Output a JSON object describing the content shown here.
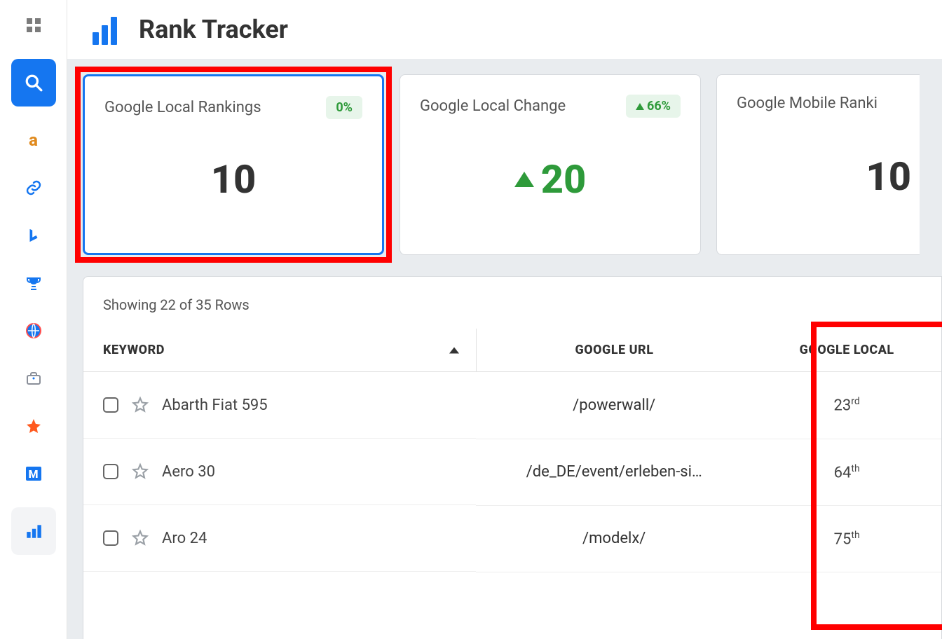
{
  "page": {
    "title": "Rank Tracker"
  },
  "cards": [
    {
      "title": "Google Local Rankings",
      "badge": "0%",
      "badge_trend": "none",
      "value": "10",
      "value_trend": "none",
      "selected": true,
      "highlight": true
    },
    {
      "title": "Google Local Change",
      "badge": "66%",
      "badge_trend": "up",
      "value": "20",
      "value_trend": "up",
      "selected": false,
      "highlight": false
    },
    {
      "title": "Google Mobile Ranki",
      "badge": "",
      "badge_trend": "none",
      "value": "10",
      "value_trend": "none",
      "selected": false,
      "highlight": false,
      "cut": true
    }
  ],
  "table": {
    "showing": "Showing 22 of 35 Rows",
    "columns": {
      "keyword": "KEYWORD",
      "url": "GOOGLE URL",
      "local": "GOOGLE LOCAL"
    },
    "rows": [
      {
        "keyword": "Abarth Fiat 595",
        "url": "/powerwall/",
        "rank": "23",
        "ord": "rd"
      },
      {
        "keyword": "Aero 30",
        "url": "/de_DE/event/erleben-si…",
        "rank": "64",
        "ord": "th"
      },
      {
        "keyword": "Aro 24",
        "url": "/modelx/",
        "rank": "75",
        "ord": "th"
      }
    ]
  }
}
